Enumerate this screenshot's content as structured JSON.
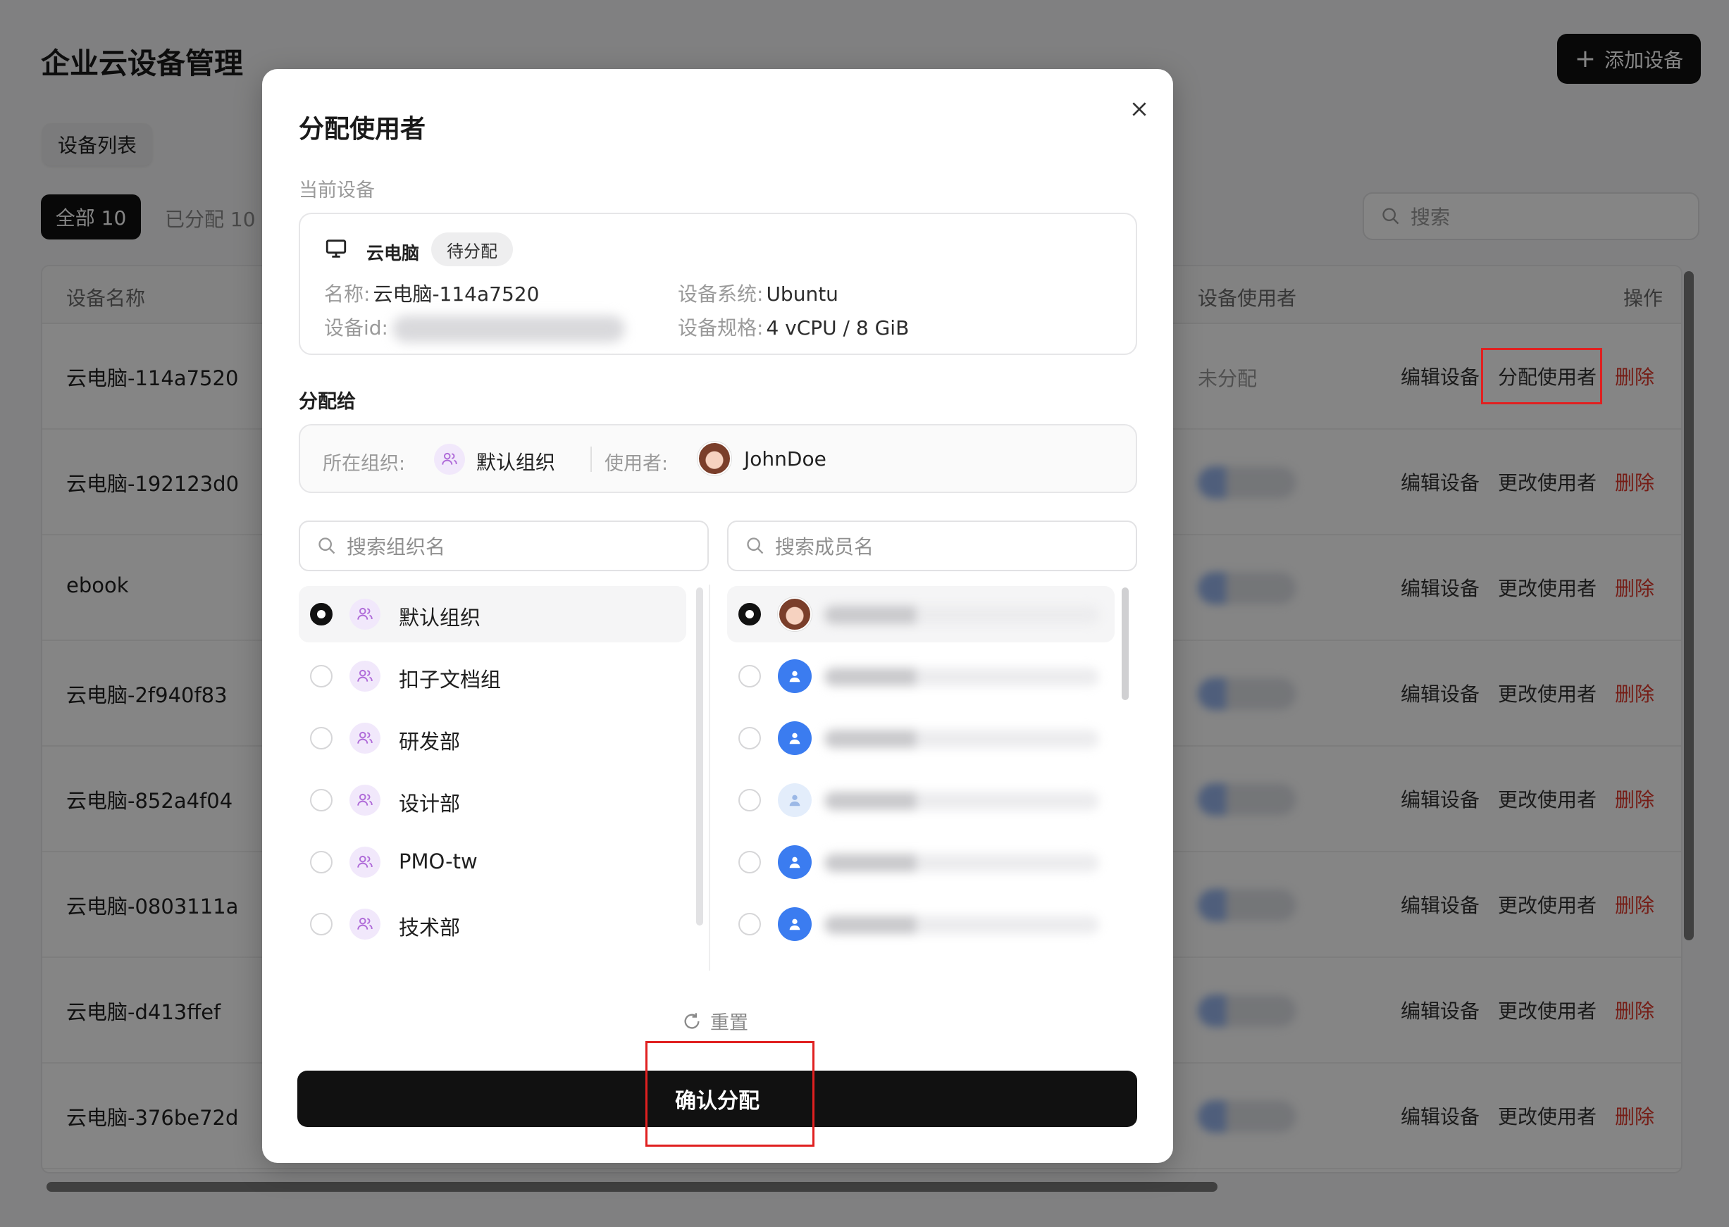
{
  "page": {
    "title": "企业云设备管理",
    "add_button": "添加设备",
    "list_tab": "设备列表",
    "filter_all": "全部 10",
    "filter_assigned": "已分配 10",
    "search_placeholder": "搜索",
    "columns": {
      "name": "设备名称",
      "user": "设备使用者",
      "actions": "操作"
    },
    "rows": [
      {
        "name": "云电脑-114a7520",
        "user_status": "未分配",
        "edit": "编辑设备",
        "assign": "分配使用者",
        "delete": "删除"
      },
      {
        "name": "云电脑-192123d0",
        "edit": "编辑设备",
        "assign": "更改使用者",
        "delete": "删除"
      },
      {
        "name": "ebook",
        "edit": "编辑设备",
        "assign": "更改使用者",
        "delete": "删除"
      },
      {
        "name": "云电脑-2f940f83",
        "edit": "编辑设备",
        "assign": "更改使用者",
        "delete": "删除"
      },
      {
        "name": "云电脑-852a4f04",
        "edit": "编辑设备",
        "assign": "更改使用者",
        "delete": "删除"
      },
      {
        "name": "云电脑-0803111a",
        "edit": "编辑设备",
        "assign": "更改使用者",
        "delete": "删除"
      },
      {
        "name": "云电脑-d413ffef",
        "edit": "编辑设备",
        "assign": "更改使用者",
        "delete": "删除"
      },
      {
        "name": "云电脑-376be72d",
        "edit": "编辑设备",
        "assign": "更改使用者",
        "delete": "删除"
      }
    ]
  },
  "modal": {
    "title": "分配使用者",
    "current_device_label": "当前设备",
    "device": {
      "type": "云电脑",
      "badge": "待分配",
      "name_label": "名称:",
      "name_value": "云电脑-114a7520",
      "id_label": "设备id:",
      "os_label": "设备系统:",
      "os_value": "Ubuntu",
      "spec_label": "设备规格:",
      "spec_value": "4 vCPU / 8 GiB"
    },
    "assign_to_label": "分配给",
    "assign_bar": {
      "org_label": "所在组织:",
      "org_value": "默认组织",
      "user_label": "使用者:",
      "user_value": "JohnDoe"
    },
    "org_search_placeholder": "搜索组织名",
    "member_search_placeholder": "搜索成员名",
    "orgs": [
      {
        "label": "默认组织",
        "selected": true
      },
      {
        "label": "扣子文档组",
        "selected": false
      },
      {
        "label": "研发部",
        "selected": false
      },
      {
        "label": "设计部",
        "selected": false
      },
      {
        "label": "PMO-tw",
        "selected": false
      },
      {
        "label": "技术部",
        "selected": false
      }
    ],
    "reset_label": "重置",
    "confirm_label": "确认分配"
  },
  "colors": {
    "primary": "#111111",
    "danger": "#e0392b",
    "highlight": "#e02020",
    "member_blue": "#3b7cf0",
    "org_purple": "#b06cd9"
  }
}
